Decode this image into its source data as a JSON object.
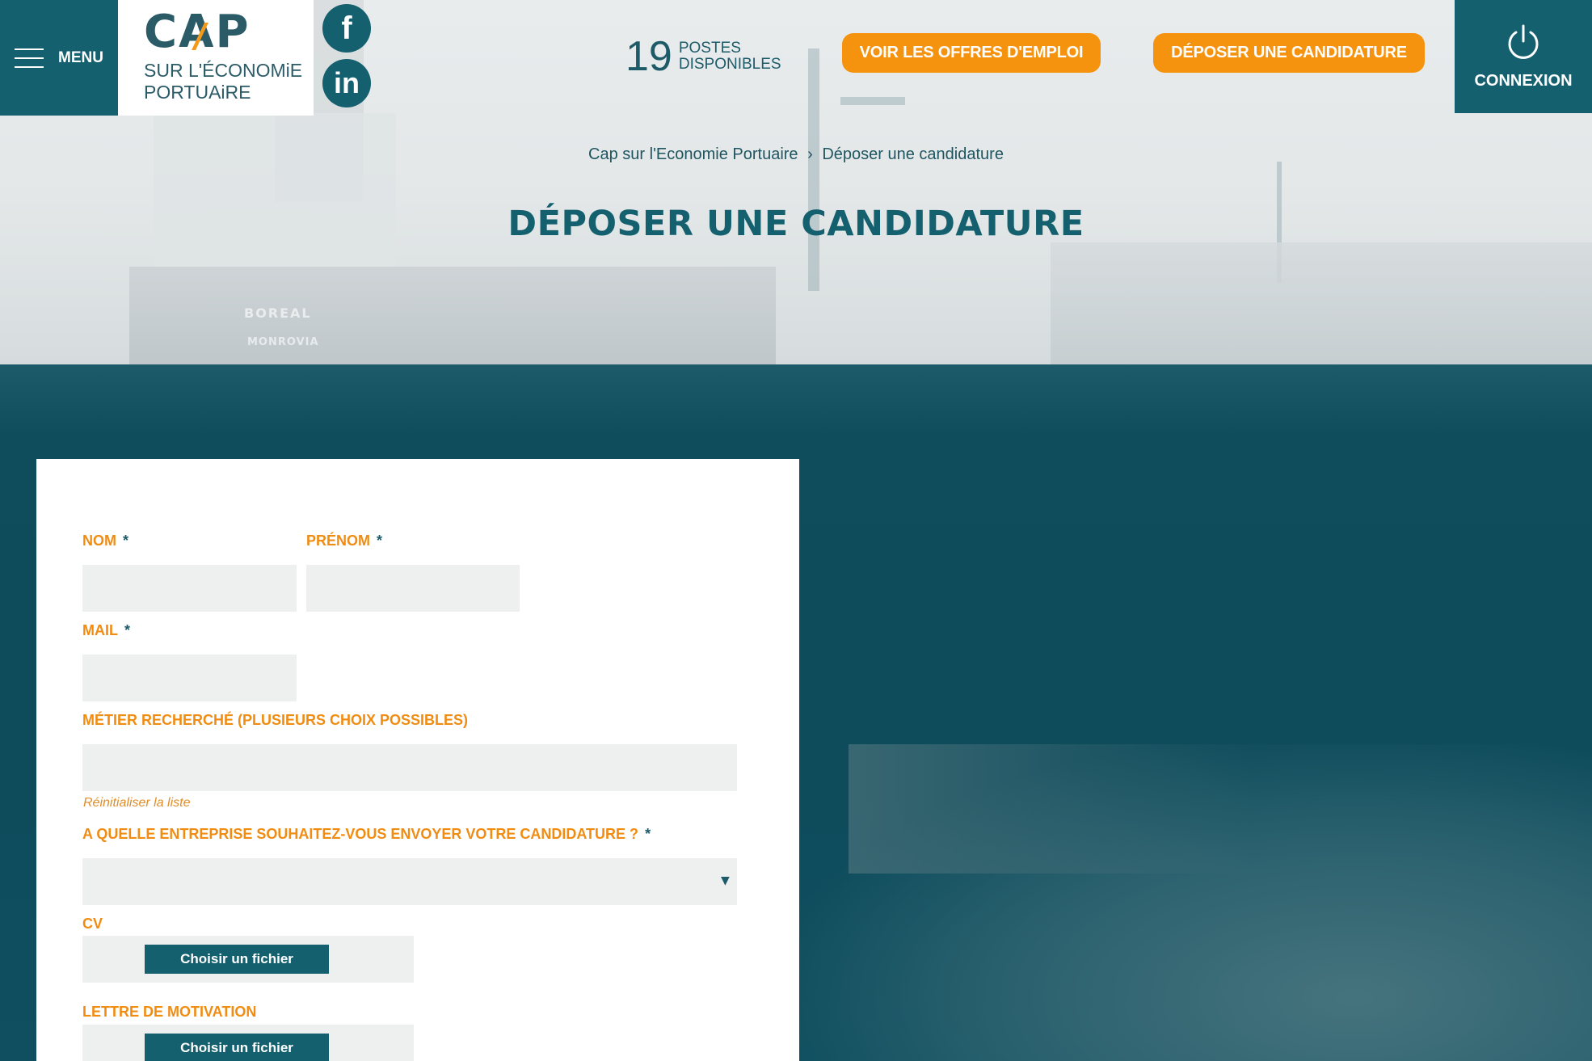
{
  "header": {
    "menu_label": "MENU",
    "logo": {
      "cap": "CAP",
      "line1": "SUR L'ÉCONOMiE",
      "line2": "PORTUAiRE"
    },
    "social": [
      {
        "name": "facebook",
        "glyph": "f"
      },
      {
        "name": "linkedin",
        "glyph": "in"
      }
    ],
    "postes": {
      "count": "19",
      "label": "POSTES\nDISPONIBLES"
    },
    "btn_offres": "VOIR LES OFFRES D'EMPLOI",
    "btn_deposer": "DÉPOSER UNE CANDIDATURE",
    "connexion_label": "CONNEXION"
  },
  "hero": {
    "breadcrumb": {
      "home": "Cap sur l'Economie Portuaire",
      "separator": "›",
      "current": "Déposer une candidature"
    },
    "title": "DÉPOSER UNE CANDIDATURE",
    "ship_name": "BOREAL",
    "ship_port": "MONROVIA"
  },
  "form": {
    "nom_label": "NOM",
    "prenom_label": "PRÉNOM",
    "mail_label": "MAIL",
    "metier_label": "MÉTIER RECHERCHÉ (PLUSIEURS CHOIX POSSIBLES)",
    "reset_label": "Réinitialiser la liste",
    "entreprise_label": "A QUELLE ENTREPRISE SOUHAITEZ-VOUS ENVOYER VOTRE CANDIDATURE ?",
    "cv_label": "CV",
    "lettre_label": "LETTRE DE MOTIVATION",
    "file_button": "Choisir un fichier",
    "required_mark": "*",
    "nom_value": "",
    "prenom_value": "",
    "mail_value": "",
    "metier_value": "",
    "entreprise_value": ""
  },
  "colors": {
    "teal": "#14606f",
    "orange": "#f5930f",
    "label_orange": "#f08c12"
  }
}
